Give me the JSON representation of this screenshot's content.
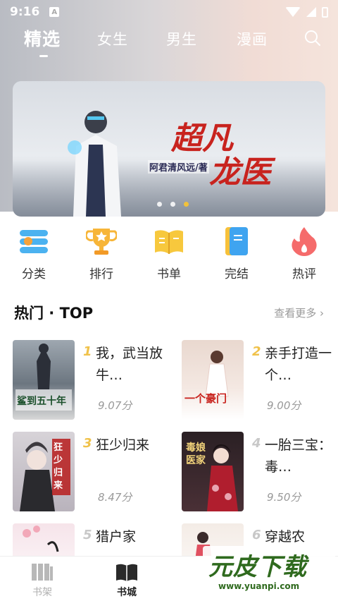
{
  "status_bar": {
    "time": "9:16",
    "notification_badge": "A"
  },
  "tabs": [
    {
      "label": "精选",
      "active": true
    },
    {
      "label": "女生",
      "active": false
    },
    {
      "label": "男生",
      "active": false
    },
    {
      "label": "漫画",
      "active": false
    }
  ],
  "banner": {
    "title_line1": "超凡",
    "title_line2": "龙医",
    "author": "阿君清风远/著",
    "slide_count": 3,
    "active_slide": 3
  },
  "categories": [
    {
      "label": "分类",
      "icon": "category-icon"
    },
    {
      "label": "排行",
      "icon": "trophy-icon"
    },
    {
      "label": "书单",
      "icon": "open-book-icon"
    },
    {
      "label": "完结",
      "icon": "finished-book-icon"
    },
    {
      "label": "热评",
      "icon": "flame-icon"
    }
  ],
  "section": {
    "title": "热门 · TOP",
    "more": "查看更多"
  },
  "books": [
    {
      "rank": "1",
      "name": "我，武当放牛…",
      "score": "9.07分",
      "cover_text": "鲨到五十年"
    },
    {
      "rank": "2",
      "name": "亲手打造一个…",
      "score": "9.00分",
      "cover_text": "一个豪门"
    },
    {
      "rank": "3",
      "name": "狂少归来",
      "score": "8.47分",
      "cover_text": "狂少归来"
    },
    {
      "rank": "4",
      "name": "一胎三宝：毒…",
      "score": "9.50分",
      "cover_text": "毒娘医家"
    },
    {
      "rank": "5",
      "name": "猎户家",
      "score": "",
      "cover_text": ""
    },
    {
      "rank": "6",
      "name": "穿越农",
      "score": "",
      "cover_text": ""
    }
  ],
  "bottom_nav": [
    {
      "label": "书架",
      "active": false
    },
    {
      "label": "书城",
      "active": true
    }
  ],
  "watermark": {
    "title": "元皮下载",
    "url": "www.yuanpi.com"
  },
  "colors": {
    "accent": "#f2c23a",
    "rank_gold": "#f0c24a",
    "rank_gray": "#c8c8c8",
    "banner_title": "#c8231e"
  }
}
